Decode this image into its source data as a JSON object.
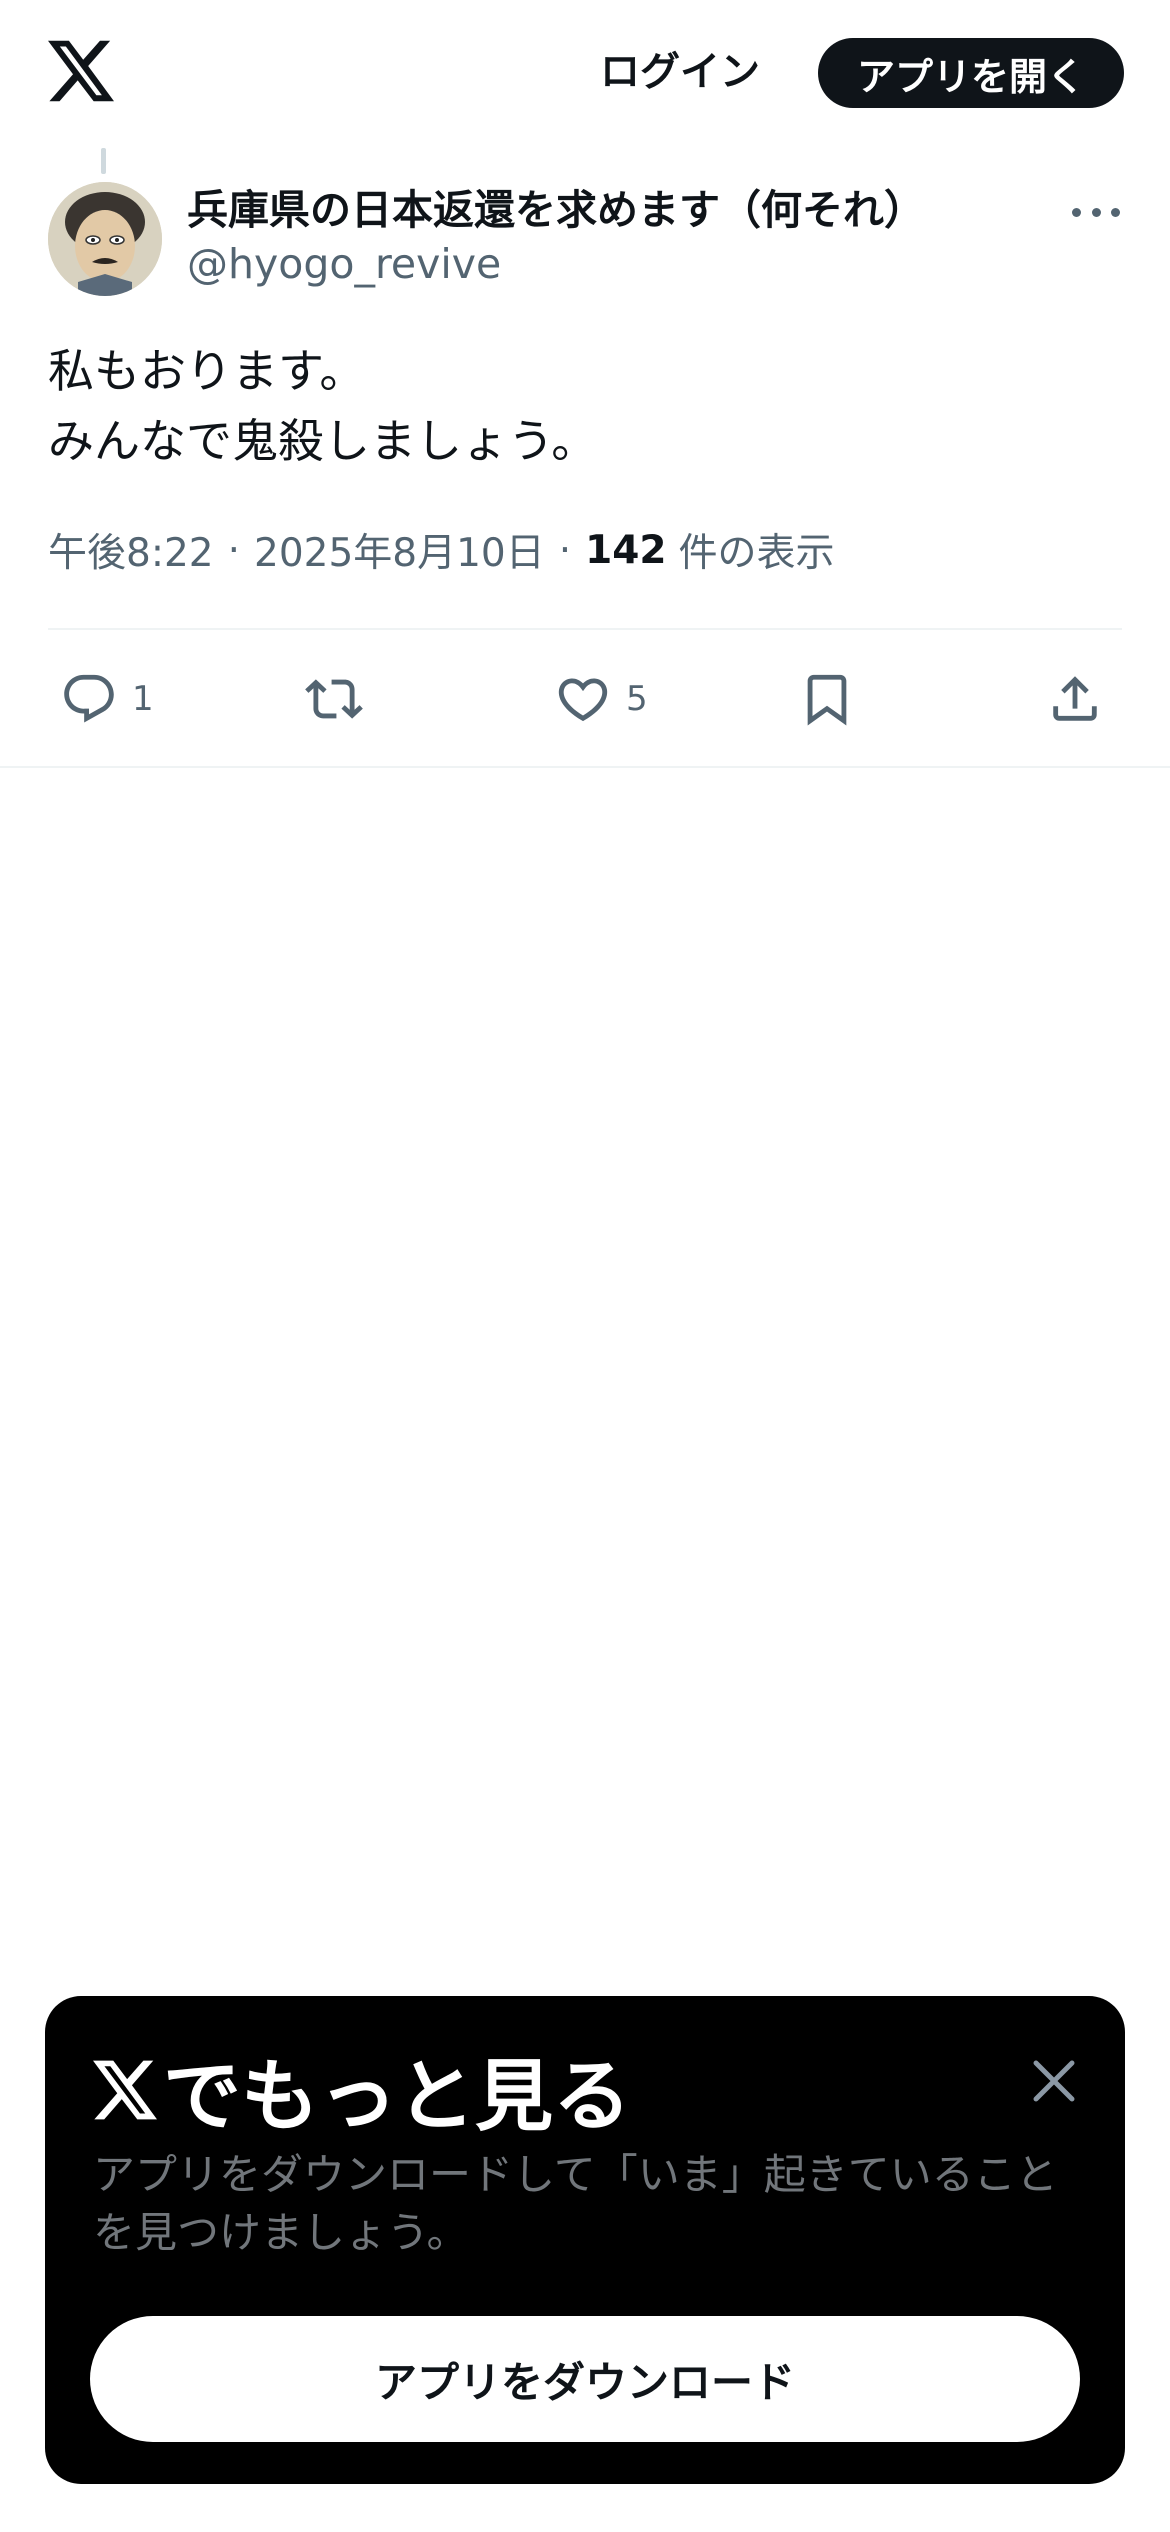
{
  "header": {
    "logo_icon": "x-logo-icon",
    "login_label": "ログイン",
    "open_app_label": "アプリを開く"
  },
  "tweet": {
    "display_name": "兵庫県の日本返還を求めます（何それ）",
    "handle": "@hyogo_revive",
    "text_lines": [
      "私もおります。",
      "みんなで鬼殺しましょう。"
    ],
    "time": "午後8:22",
    "date": "2025年8月10日",
    "separator": "·",
    "views_count": "142",
    "views_label": "件の表示",
    "actions": {
      "reply_count": "1",
      "like_count": "5"
    }
  },
  "sheet": {
    "title": "でもっと見る",
    "description_lines": [
      "アプリをダウンロードして「いま」起きていること",
      "を見つけましょう。"
    ],
    "download_label": "アプリをダウンロード"
  },
  "colors": {
    "text_primary": "#0f1419",
    "text_secondary": "#536471",
    "sheet_bg": "#000000",
    "sheet_text_muted": "#71767b"
  }
}
